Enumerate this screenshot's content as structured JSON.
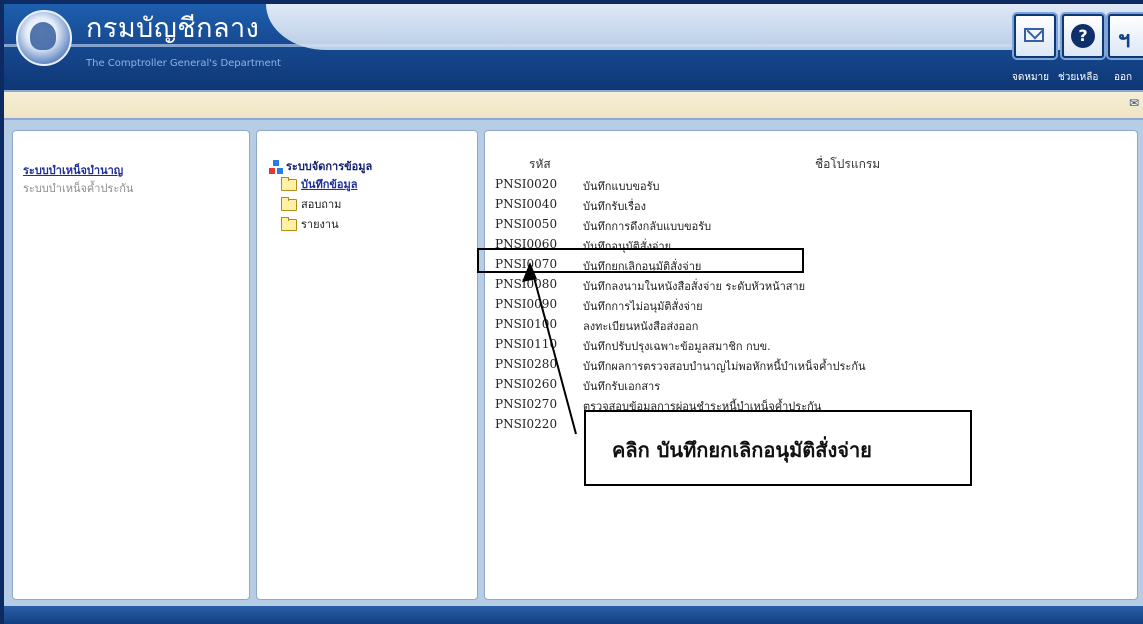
{
  "header": {
    "title_th": "กรมบัญชีกลาง",
    "title_en": "The Comptroller General's Department",
    "buttons": {
      "mail": "จดหมาย",
      "help": "ช่วยเหลือ",
      "exit": "ออก"
    }
  },
  "left_menu": {
    "items": [
      "ระบบบำเหน็จบำนาญ",
      "ระบบบำเหน็จค้ำประกัน"
    ]
  },
  "tree": {
    "root": "ระบบจัดการข้อมูล",
    "items": [
      "บันทึกข้อมูล",
      "สอบถาม",
      "รายงาน"
    ]
  },
  "program_table": {
    "headers": {
      "code": "รหัส",
      "name": "ชื่อโปรแกรม"
    },
    "rows": [
      {
        "code": "PNSI0020",
        "name": "บันทึกแบบขอรับ"
      },
      {
        "code": "PNSI0040",
        "name": "บันทึกรับเรื่อง"
      },
      {
        "code": "PNSI0050",
        "name": "บันทึกการดึงกลับแบบขอรับ"
      },
      {
        "code": "PNSI0060",
        "name": "บันทึกอนุมัติสั่งจ่าย"
      },
      {
        "code": "PNSI0070",
        "name": "บันทึกยกเลิกอนุมัติสั่งจ่าย"
      },
      {
        "code": "PNSI0080",
        "name": "บันทึกลงนามในหนังสือสั่งจ่าย ระดับหัวหน้าสาย"
      },
      {
        "code": "PNSI0090",
        "name": "บันทึกการไม่อนุมัติสั่งจ่าย"
      },
      {
        "code": "PNSI0100",
        "name": "ลงทะเบียนหนังสือส่งออก"
      },
      {
        "code": "PNSI0110",
        "name": "บันทึกปรับปรุงเฉพาะข้อมูลสมาชิก กบข."
      },
      {
        "code": "PNSI0280",
        "name": "บันทึกผลการตรวจสอบบำนาญไม่พอหักหนี้บำเหน็จค้ำประกัน"
      },
      {
        "code": "PNSI0260",
        "name": "บันทึกรับเอกสาร"
      },
      {
        "code": "PNSI0270",
        "name": "ตรวจสอบข้อมูลการผ่อนชำระหนี้บำเหน็จค้ำประกัน"
      },
      {
        "code": "PNSI0220",
        "name": ""
      }
    ]
  },
  "annotation": {
    "callout_text": "คลิก บันทึกยกเลิกอนุมัติสั่งจ่าย"
  },
  "colors": {
    "header_blue": "#174a92",
    "link_blue": "#1f2f9a",
    "panel_bg": "#b7cde6",
    "toolbar_bg": "#f3e9cc"
  }
}
